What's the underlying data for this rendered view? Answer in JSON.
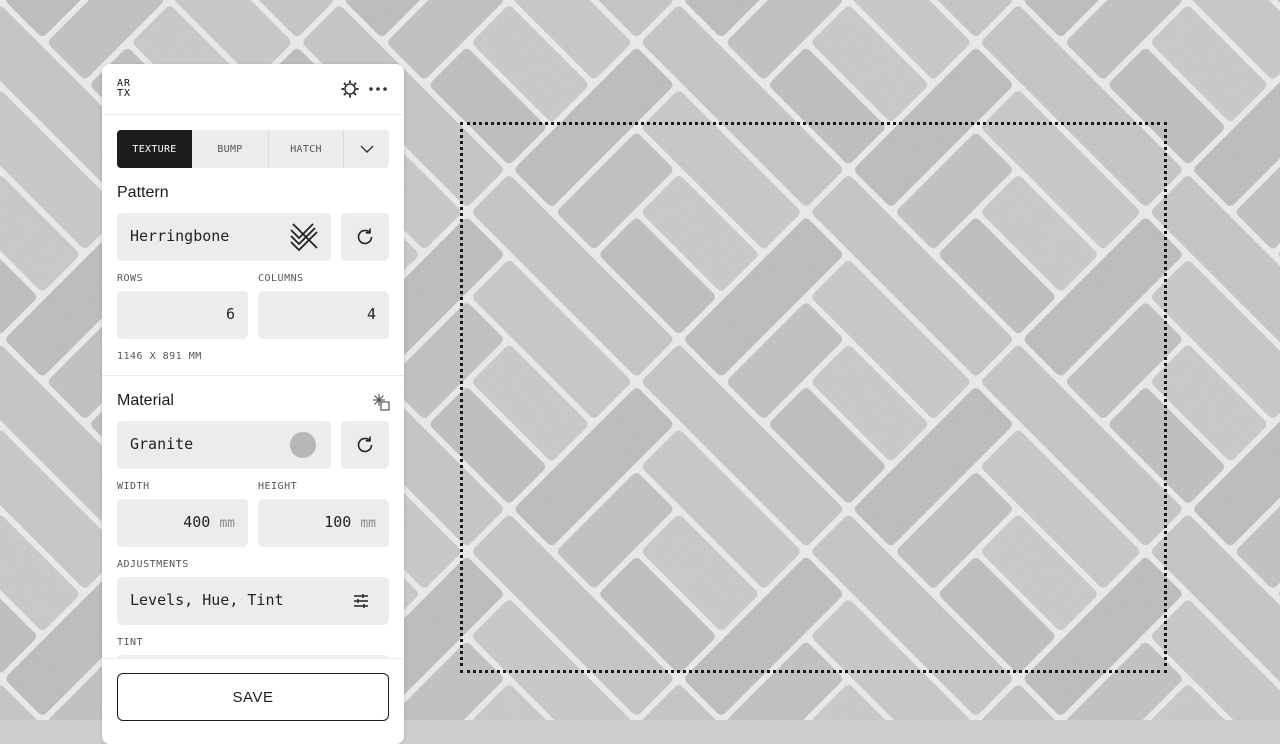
{
  "header": {
    "logo_top": "AR",
    "logo_bottom": "TX"
  },
  "tabs": [
    {
      "label": "TEXTURE",
      "active": true
    },
    {
      "label": "BUMP",
      "active": false
    },
    {
      "label": "HATCH",
      "active": false
    }
  ],
  "pattern": {
    "title": "Pattern",
    "value": "Herringbone",
    "rows_label": "ROWS",
    "rows": "6",
    "columns_label": "COLUMNS",
    "columns": "4",
    "dimensions": "1146 X 891 MM"
  },
  "material": {
    "title": "Material",
    "value": "Granite",
    "width_label": "WIDTH",
    "width": "400",
    "height_label": "HEIGHT",
    "height": "100",
    "unit": "mm",
    "adjustments_label": "ADJUSTMENTS",
    "adjustments_value": "Levels, Hue, Tint",
    "tint_label": "TINT"
  },
  "actions": {
    "save_label": "SAVE"
  },
  "colors": {
    "accent": "#1c1c1c",
    "field_bg": "#ececeb",
    "panel_bg": "#ffffff"
  }
}
